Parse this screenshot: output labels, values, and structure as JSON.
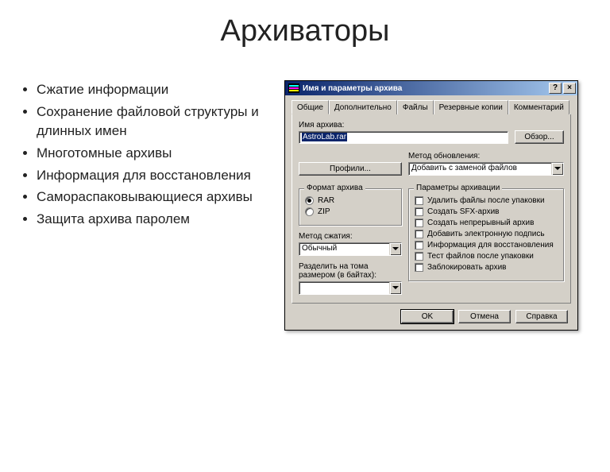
{
  "slide": {
    "title": "Архиваторы"
  },
  "bullets": [
    "Сжатие информации",
    "Сохранение файловой структуры и длинных имен",
    "Многотомные архивы",
    "Информация для восстановления",
    "Самораспаковывающиеся архивы",
    "Защита архива паролем"
  ],
  "dialog": {
    "title": "Имя и параметры архива",
    "help_btn": "?",
    "close_btn": "×",
    "tabs": [
      "Общие",
      "Дополнительно",
      "Файлы",
      "Резервные копии",
      "Комментарий"
    ],
    "active_tab": 0,
    "archive_name_label": "Имя архива:",
    "archive_name_value": "AstroLab.rar",
    "browse_btn": "Обзор...",
    "profiles_btn": "Профили...",
    "update_method_label": "Метод обновления:",
    "update_method_value": "Добавить с заменой файлов",
    "format_group": "Формат архива",
    "format_rar": "RAR",
    "format_zip": "ZIP",
    "format_selected": "RAR",
    "compress_label": "Метод сжатия:",
    "compress_value": "Обычный",
    "split_label": "Разделить на тома размером (в байтах):",
    "split_value": "",
    "params_group": "Параметры архивации",
    "params": [
      "Удалить файлы после упаковки",
      "Создать SFX-архив",
      "Создать непрерывный архив",
      "Добавить электронную подпись",
      "Информация для восстановления",
      "Тест файлов после упаковки",
      "Заблокировать архив"
    ],
    "ok": "OK",
    "cancel": "Отмена",
    "help": "Справка"
  }
}
